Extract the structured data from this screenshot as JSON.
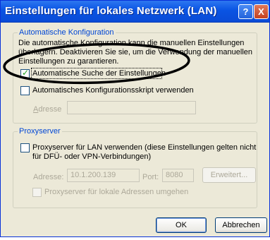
{
  "window": {
    "title": "Einstellungen für lokales Netzwerk (LAN)",
    "help_label": "?",
    "close_label": "X"
  },
  "auto_config": {
    "legend": "Automatische Konfiguration",
    "description_line1": "Die automatische Konfiguration kann die manuellen Einstellungen",
    "description_line2": "überlagern. Deaktivieren Sie sie, um die Verwendung der manuellen",
    "description_line3": "Einstellungen zu garantieren.",
    "auto_detect_label": "Automatische Suche der Einstellungen",
    "auto_detect_checked": true,
    "script_label": "Automatisches Konfigurationsskript verwenden",
    "script_checked": false,
    "address_label": "Adresse",
    "address_value": ""
  },
  "proxy": {
    "legend": "Proxyserver",
    "use_proxy_line1": "Proxyserver für LAN verwenden (diese Einstellungen gelten nicht",
    "use_proxy_line2": "für DFÜ- oder VPN-Verbindungen)",
    "use_proxy_checked": false,
    "address_label": "Adresse:",
    "address_value": "10.1.200.139",
    "port_label": "Port:",
    "port_value": "8080",
    "advanced_label": "Erweitert...",
    "bypass_label": "Proxyserver für lokale Adressen umgehen",
    "bypass_checked": false
  },
  "buttons": {
    "ok": "OK",
    "cancel": "Abbrechen"
  },
  "colors": {
    "titlebar": "#0A54E3",
    "dialog": "#ECE9D8",
    "legend": "#0046D5",
    "annotation": "#000000"
  }
}
